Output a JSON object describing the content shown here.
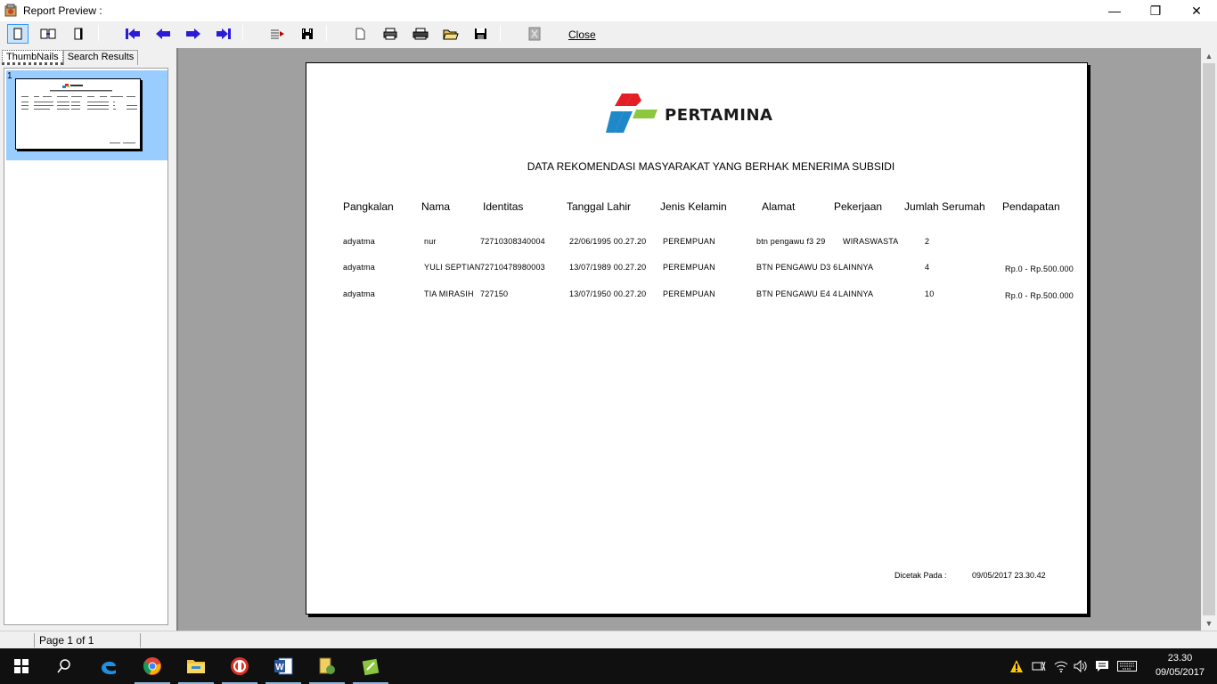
{
  "window": {
    "title": "Report Preview :",
    "buttons": {
      "minimize": "—",
      "restore": "❐",
      "close": "✕"
    }
  },
  "toolbar": {
    "close_label": "Close",
    "icons": [
      "one-page-icon",
      "two-page-icon",
      "page-width-icon",
      "first-page-icon",
      "prev-page-icon",
      "next-page-icon",
      "last-page-icon",
      "goto-page-icon",
      "find-icon",
      "page-setup-icon",
      "printer-setup-icon",
      "print-icon",
      "open-icon",
      "save-icon",
      "export-icon"
    ]
  },
  "sidebar": {
    "tabs": [
      {
        "label": "ThumbNails",
        "selected": true
      },
      {
        "label": "Search Results",
        "selected": false
      }
    ],
    "thumbnail_number": "1"
  },
  "report": {
    "logo_text": "PERTAMINA",
    "logo_colors": {
      "red": "#e31e24",
      "green": "#8dc63f",
      "blue": "#1e88c8"
    },
    "title": "DATA REKOMENDASI MASYARAKAT YANG BERHAK MENERIMA SUBSIDI",
    "columns": [
      "Pangkalan",
      "Nama",
      "Identitas",
      "Tanggal Lahir",
      "Jenis Kelamin",
      "Alamat",
      "Pekerjaan",
      "Jumlah Serumah",
      "Pendapatan"
    ],
    "rows": [
      [
        "adyatma",
        "nur",
        "7271030834000​4",
        "22/06/1995 00.27.20",
        "PEREMPUAN",
        "btn pengawu f3 29",
        "WIRASWASTA",
        "2",
        ""
      ],
      [
        "adyatma",
        "YULI SEPTIAN",
        "7271047898000​3",
        "13/07/1989 00.27.20",
        "PEREMPUAN",
        "BTN PENGAWU D3 6",
        "LAINNYA",
        "4",
        "Rp.0 - Rp.500.000"
      ],
      [
        "adyatma",
        "TIA MIRASIH",
        "727150",
        "13/07/1950 00.27.20",
        "PEREMPUAN",
        "BTN PENGAWU E4 4",
        "LAINNYA",
        "10",
        "Rp.0 - Rp.500.000"
      ]
    ],
    "footer_label": "Dicetak Pada :",
    "footer_value": "09/05/2017 23.30.42"
  },
  "status": {
    "page_info": "Page 1 of 1"
  },
  "taskbar": {
    "apps": [
      "windows-start-icon",
      "search-icon",
      "edge-icon",
      "chrome-icon",
      "file-explorer-icon",
      "app-red-icon",
      "word-icon",
      "file-manager-icon",
      "notepad-plus-icon"
    ],
    "time": "23.30",
    "date": "09/05/2017"
  }
}
